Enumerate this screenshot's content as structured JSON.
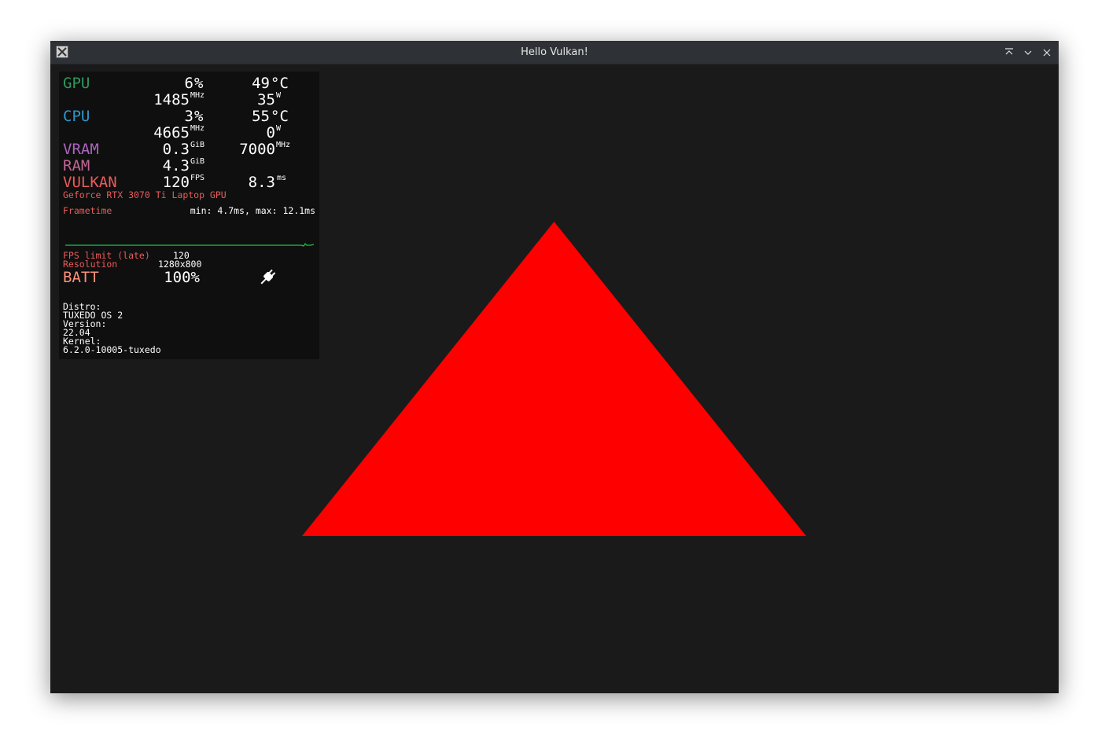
{
  "window": {
    "title": "Hello Vulkan!"
  },
  "icons": {
    "app": "x-window-icon",
    "keep_above": "keep-above-icon",
    "minimize": "minimize-icon",
    "close": "close-icon",
    "power": "power-plug-icon"
  },
  "colors": {
    "gpu": "#2e9a5c",
    "cpu": "#2e97cb",
    "vram": "#ad64c1",
    "ram": "#c26693",
    "vulkan": "#eb5b5b",
    "batt": "#ff9078",
    "triangle": "#ff0000",
    "graph": "#22c44a"
  },
  "hud": {
    "gpu": {
      "label": "GPU",
      "load": "6",
      "load_unit": "%",
      "temp": "49",
      "temp_unit": "°C",
      "clock": "1485",
      "clock_unit": "MHz",
      "power": "35",
      "power_unit": "W"
    },
    "cpu": {
      "label": "CPU",
      "load": "3",
      "load_unit": "%",
      "temp": "55",
      "temp_unit": "°C",
      "clock": "4665",
      "clock_unit": "MHz",
      "power": "0",
      "power_unit": "W"
    },
    "vram": {
      "label": "VRAM",
      "value": "0.3",
      "unit": "GiB",
      "clock": "7000",
      "clock_unit": "MHz"
    },
    "ram": {
      "label": "RAM",
      "value": "4.3",
      "unit": "GiB"
    },
    "vulkan": {
      "label": "VULKAN",
      "fps": "120",
      "fps_unit": "FPS",
      "frametime": "8.3",
      "frametime_unit": "ms"
    },
    "gpu_name": "Geforce RTX 3070 Ti Laptop GPU",
    "frametime_label": "Frametime",
    "frametime_stats": "min: 4.7ms, max: 12.1ms",
    "fps_limit_label": "FPS limit (late)",
    "fps_limit_value": "120",
    "resolution_label": "Resolution",
    "resolution_value": "1280x800",
    "batt": {
      "label": "BATT",
      "value": "100%"
    },
    "distro_label": "Distro:",
    "distro_value": "TUXEDO OS 2",
    "version_label": "Version:",
    "version_value": "22.04",
    "kernel_label": "Kernel:",
    "kernel_value": "6.2.0-10005-tuxedo"
  }
}
